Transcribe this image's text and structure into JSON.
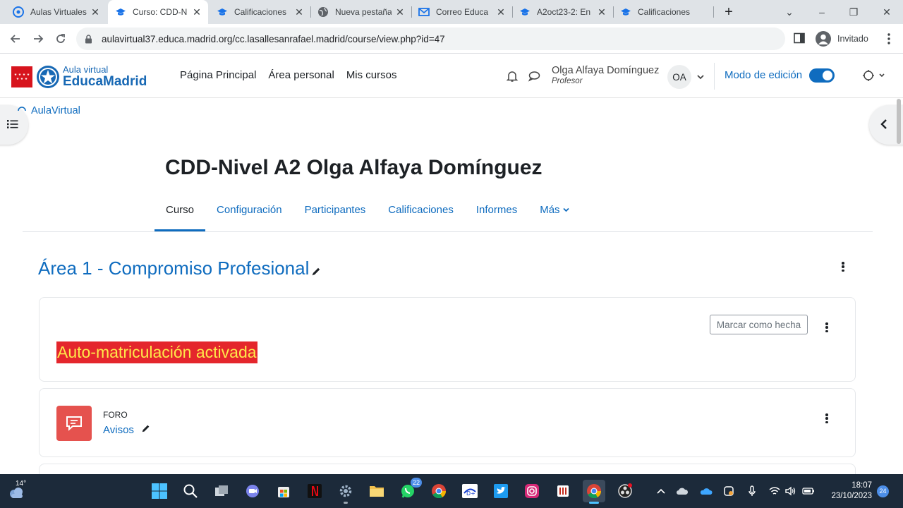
{
  "browser": {
    "tabs": [
      {
        "title": "Aulas Virtuales",
        "icon": "chrome-globe-icon"
      },
      {
        "title": "Curso: CDD-N",
        "icon": "moodle-cap-icon",
        "active": true
      },
      {
        "title": "Calificaciones",
        "icon": "moodle-cap-icon"
      },
      {
        "title": "Nueva pestaña",
        "icon": "globe-icon"
      },
      {
        "title": "Correo Educa",
        "icon": "mail-icon"
      },
      {
        "title": "A2oct23-2: En",
        "icon": "moodle-cap-icon"
      },
      {
        "title": "Calificaciones",
        "icon": "moodle-cap-icon"
      }
    ],
    "url": "aulavirtual37.educa.madrid.org/cc.lasallesanrafael.madrid/course/view.php?id=47",
    "profile_label": "Invitado"
  },
  "header": {
    "brand_line1": "Aula virtual",
    "brand_line2": "EducaMadrid",
    "nav": [
      "Página Principal",
      "Área personal",
      "Mis cursos"
    ],
    "user_name": "Olga Alfaya Domínguez",
    "user_role": "Profesor",
    "user_initials": "OA",
    "edit_mode_label": "Modo de edición",
    "edit_mode_on": true
  },
  "page": {
    "breadcrumb": "AulaVirtual",
    "course_title": "CDD-Nivel A2 Olga Alfaya Domínguez",
    "secondary_nav": [
      "Curso",
      "Configuración",
      "Participantes",
      "Calificaciones",
      "Informes",
      "Más"
    ],
    "active_nav": "Curso",
    "section_title": "Área 1 - Compromiso Profesional",
    "label_card": {
      "mark_done": "Marcar como hecha",
      "highlight_text": "Auto-matriculación activada"
    },
    "forum_card": {
      "type": "FORO",
      "name": "Avisos"
    }
  },
  "taskbar": {
    "weather_temp": "14°",
    "whatsapp_badge": "22",
    "time": "18:07",
    "date": "23/10/2023",
    "notification_count": "24"
  },
  "colors": {
    "accent": "#0f6cbf",
    "highlight_bg": "#e4262c",
    "highlight_text": "#ffe84a",
    "forum_icon_bg": "#e5524e",
    "taskbar_bg": "#1c2a3a"
  }
}
